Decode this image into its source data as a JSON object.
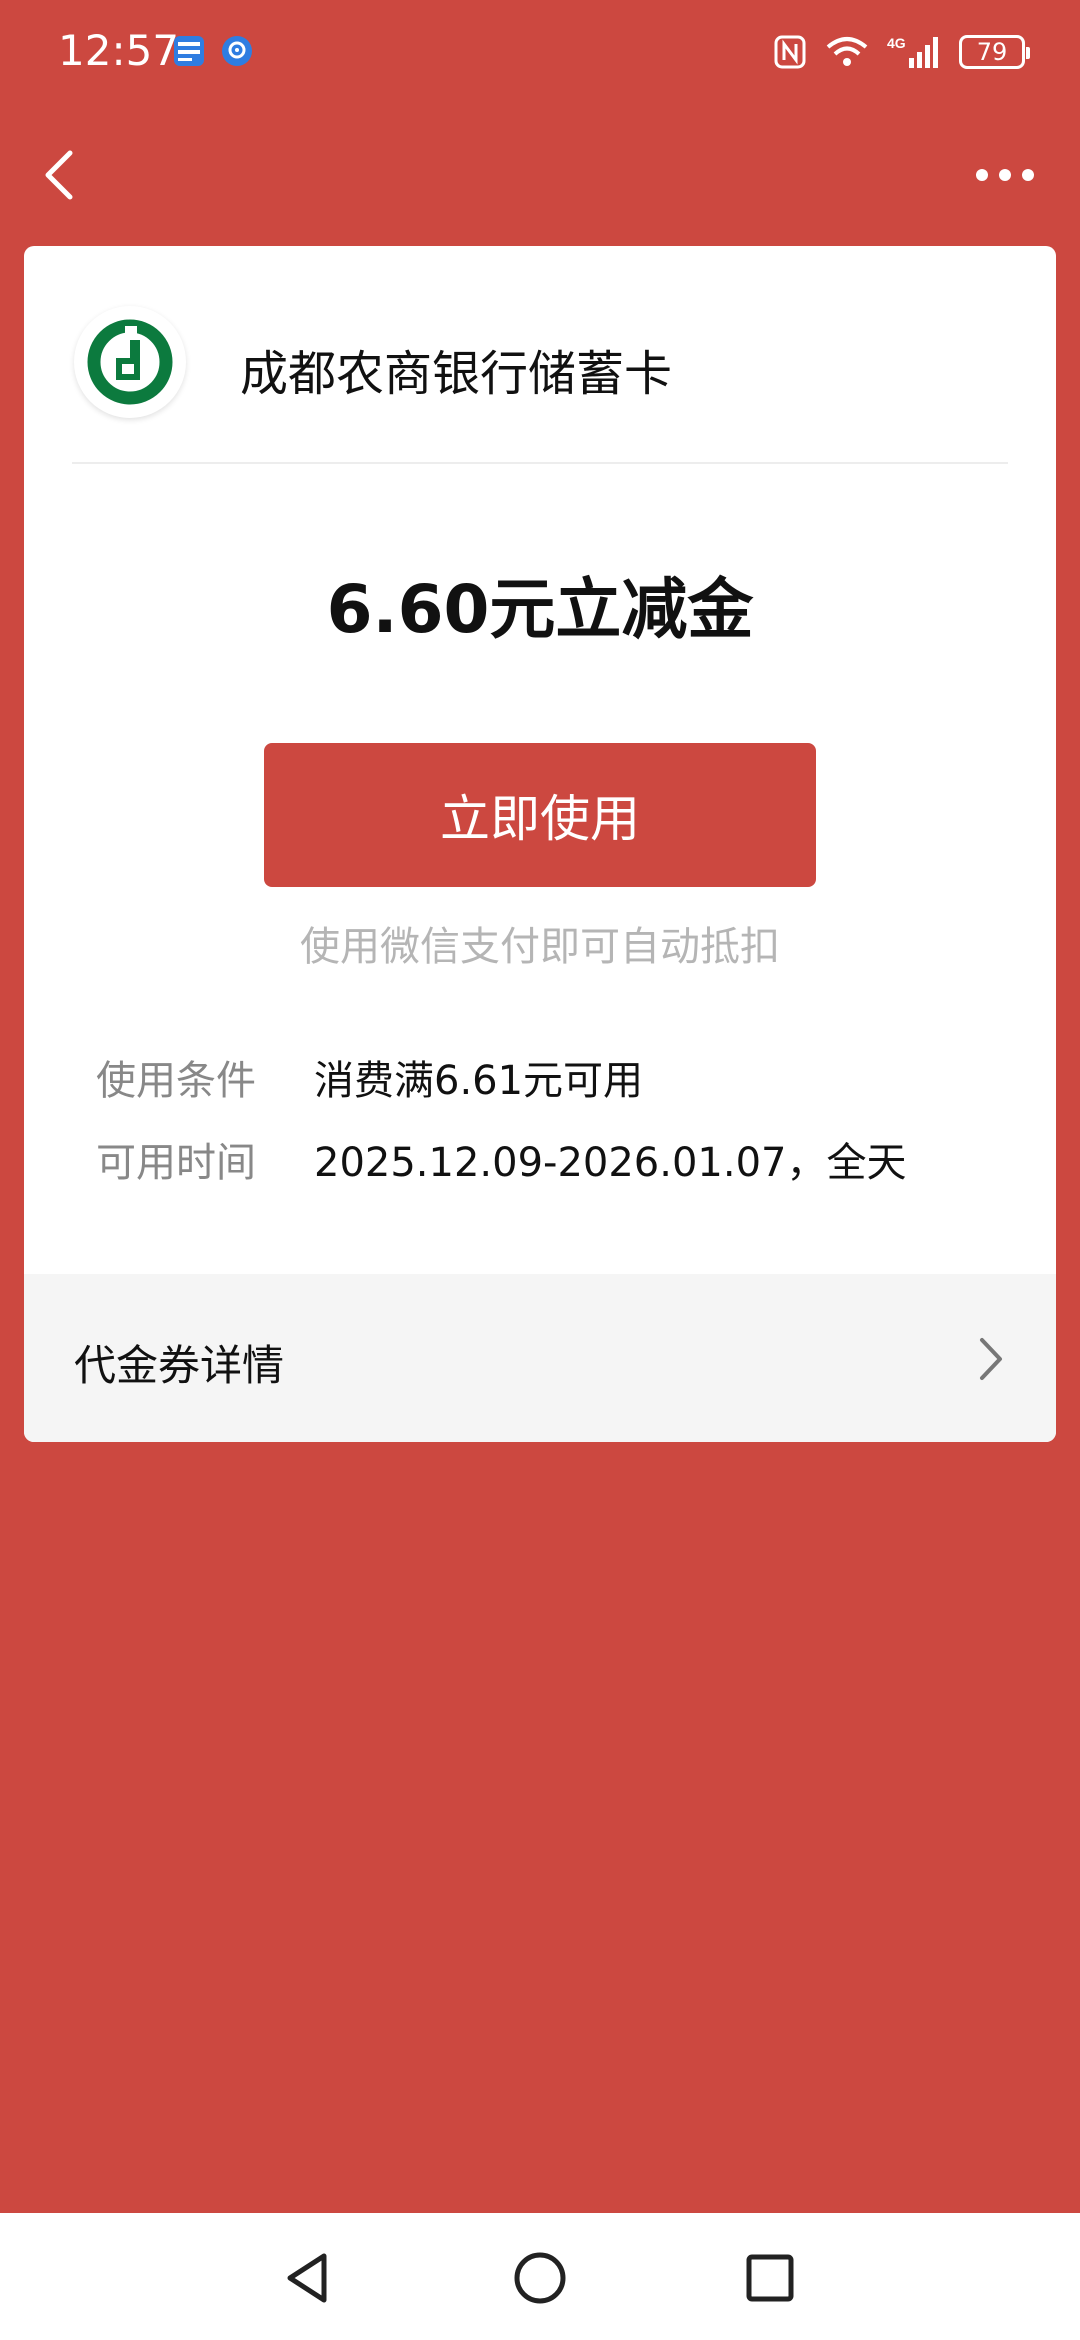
{
  "status_bar": {
    "time": "12:57",
    "battery": "79",
    "network": "4G"
  },
  "nav": {
    "back_icon": "back-icon",
    "more_icon": "more-icon"
  },
  "card": {
    "bank_name": "成都农商银行储蓄卡",
    "amount_title": "6.60元立减金",
    "use_button": "立即使用",
    "hint": "使用微信支付即可自动抵扣",
    "conditions": [
      {
        "label": "使用条件",
        "value": "消费满6.61元可用"
      },
      {
        "label": "可用时间",
        "value": "2025.12.09-2026.01.07，全天"
      }
    ],
    "detail_label": "代金券详情"
  },
  "colors": {
    "background": "#cc4840",
    "button": "#cc4840",
    "logo_green": "#0c7a3e"
  }
}
